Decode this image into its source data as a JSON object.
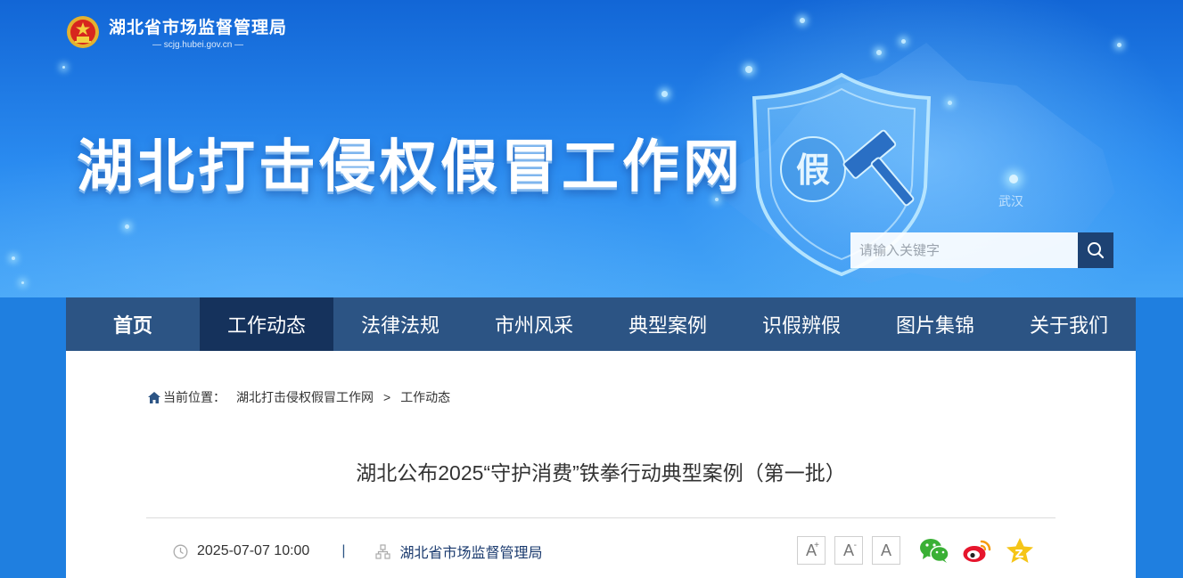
{
  "header": {
    "org_name": "湖北省市场监督管理局",
    "org_domain": "scjg.hubei.gov.cn",
    "site_title": "湖北打击侵权假冒工作网",
    "map_city_label": "武汉",
    "shield_text": "假"
  },
  "search": {
    "placeholder": "请输入关键字"
  },
  "nav": {
    "items": [
      {
        "label": "首页"
      },
      {
        "label": "工作动态"
      },
      {
        "label": "法律法规"
      },
      {
        "label": "市州风采"
      },
      {
        "label": "典型案例"
      },
      {
        "label": "识假辨假"
      },
      {
        "label": "图片集锦"
      },
      {
        "label": "关于我们"
      }
    ],
    "active_index": 1
  },
  "breadcrumb": {
    "prefix": "当前位置：",
    "items": [
      "湖北打击侵权假冒工作网",
      "工作动态"
    ],
    "separator": ">"
  },
  "article": {
    "title": "湖北公布2025“守护消费”铁拳行动典型案例（第一批）",
    "date": "2025-07-07 10:00",
    "meta_separator": "|",
    "source": "湖北省市场监督管理局"
  },
  "font_size": {
    "increase": "A",
    "decrease": "A",
    "reset": "A",
    "increase_mark": "+",
    "decrease_mark": "-"
  },
  "share": {
    "icons": [
      "wechat-icon",
      "weibo-icon",
      "favorite-icon"
    ]
  },
  "colors": {
    "nav_bg": "#2c5484",
    "nav_active": "#15325c",
    "banner_top": "#1266d6",
    "banner_bottom": "#46a6f7",
    "search_button": "#1d4273",
    "wechat": "#3ab035",
    "weibo": "#e6162d",
    "star": "#f5c518"
  }
}
